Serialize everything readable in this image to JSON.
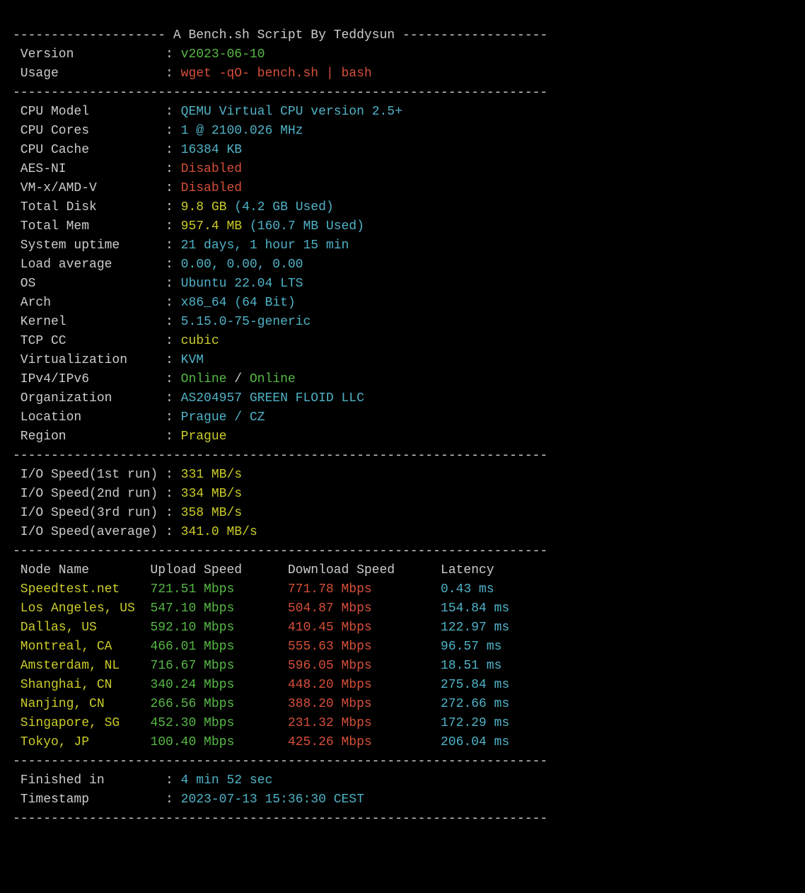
{
  "divtop": "-------------------- A Bench.sh Script By Teddysun -------------------",
  "div": "----------------------------------------------------------------------",
  "labels": {
    "version": " Version            ",
    "usage": " Usage              ",
    "cpu_model": " CPU Model          ",
    "cpu_cores": " CPU Cores          ",
    "cpu_cache": " CPU Cache          ",
    "aes_ni": " AES-NI             ",
    "vmx": " VM-x/AMD-V         ",
    "total_disk": " Total Disk         ",
    "total_mem": " Total Mem          ",
    "uptime": " System uptime      ",
    "load": " Load average       ",
    "os": " OS                 ",
    "arch": " Arch               ",
    "kernel": " Kernel             ",
    "tcpcc": " TCP CC             ",
    "virt": " Virtualization     ",
    "ipv": " IPv4/IPv6          ",
    "org": " Organization       ",
    "location": " Location           ",
    "region": " Region             ",
    "io1": " I/O Speed(1st run) ",
    "io2": " I/O Speed(2nd run) ",
    "io3": " I/O Speed(3rd run) ",
    "ioavg": " I/O Speed(average) ",
    "finished": " Finished in        ",
    "timestamp": " Timestamp          "
  },
  "info": {
    "version": "v2023-06-10",
    "usage": "wget -qO- bench.sh | bash",
    "cpu_model": "QEMU Virtual CPU version 2.5+",
    "cpu_cores": "1 @ 2100.026 MHz",
    "cpu_cache": "16384 KB",
    "aes_ni": "Disabled",
    "vmx": "Disabled",
    "disk_total": "9.8 GB ",
    "disk_used": "(4.2 GB Used)",
    "mem_total": "957.4 MB ",
    "mem_used": "(160.7 MB Used)",
    "uptime": "21 days, 1 hour 15 min",
    "load": "0.00, 0.00, 0.00",
    "os": "Ubuntu 22.04 LTS",
    "arch": "x86_64 (64 Bit)",
    "kernel": "5.15.0-75-generic",
    "tcpcc": "cubic",
    "virt": "KVM",
    "ipv4": "Online",
    "ipsep": " / ",
    "ipv6": "Online",
    "org": "AS204957 GREEN FLOID LLC",
    "location": "Prague / CZ",
    "region": "Prague"
  },
  "io": {
    "r1": "331 MB/s",
    "r2": "334 MB/s",
    "r3": "358 MB/s",
    "avg": "341.0 MB/s"
  },
  "speed": {
    "header": " Node Name        Upload Speed      Download Speed      Latency     ",
    "rows": [
      {
        "name": " Speedtest.net    ",
        "up": "721.51 Mbps       ",
        "down": "771.78 Mbps         ",
        "lat": "0.43 ms    "
      },
      {
        "name": " Los Angeles, US  ",
        "up": "547.10 Mbps       ",
        "down": "504.87 Mbps         ",
        "lat": "154.84 ms  "
      },
      {
        "name": " Dallas, US       ",
        "up": "592.10 Mbps       ",
        "down": "410.45 Mbps         ",
        "lat": "122.97 ms  "
      },
      {
        "name": " Montreal, CA     ",
        "up": "466.01 Mbps       ",
        "down": "555.63 Mbps         ",
        "lat": "96.57 ms   "
      },
      {
        "name": " Amsterdam, NL    ",
        "up": "716.67 Mbps       ",
        "down": "596.05 Mbps         ",
        "lat": "18.51 ms   "
      },
      {
        "name": " Shanghai, CN     ",
        "up": "340.24 Mbps       ",
        "down": "448.20 Mbps         ",
        "lat": "275.84 ms  "
      },
      {
        "name": " Nanjing, CN      ",
        "up": "266.56 Mbps       ",
        "down": "388.20 Mbps         ",
        "lat": "272.66 ms  "
      },
      {
        "name": " Singapore, SG    ",
        "up": "452.30 Mbps       ",
        "down": "231.32 Mbps         ",
        "lat": "172.29 ms  "
      },
      {
        "name": " Tokyo, JP        ",
        "up": "100.40 Mbps       ",
        "down": "425.26 Mbps         ",
        "lat": "206.04 ms  "
      }
    ]
  },
  "footer": {
    "finished": "4 min 52 sec",
    "timestamp": "2023-07-13 15:36:30 CEST"
  }
}
